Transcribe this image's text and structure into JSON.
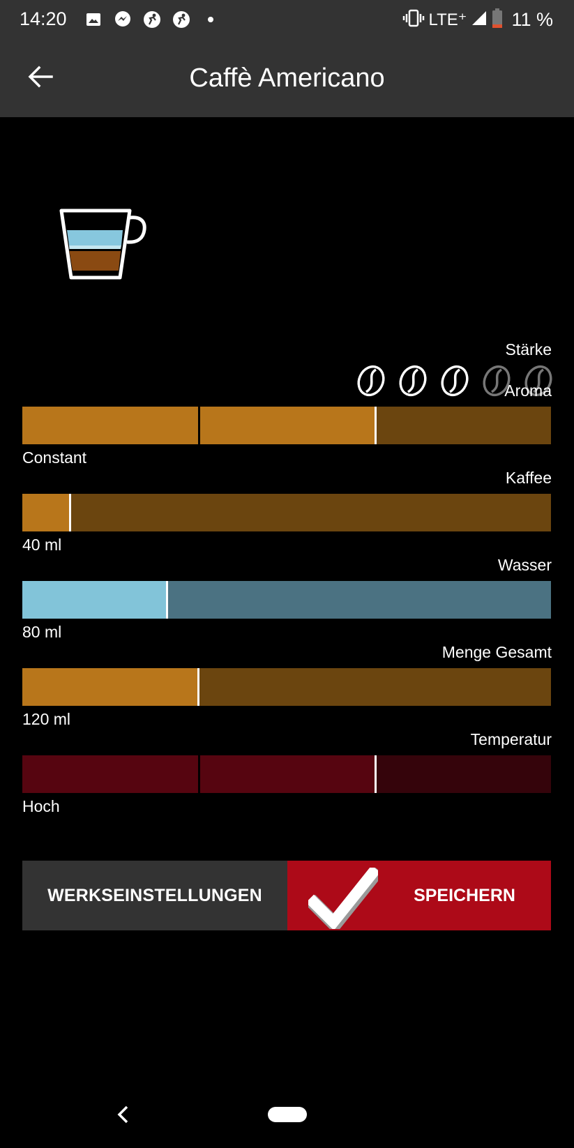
{
  "status_bar": {
    "time": "14:20",
    "network": "LTE⁺",
    "battery": "11 %",
    "icons": [
      "image-icon",
      "messenger-icon",
      "soccer-icon",
      "soccer-icon",
      "dot-icon",
      "vibrate-icon",
      "signal-icon",
      "battery-low-icon"
    ]
  },
  "header": {
    "title": "Caffè Americano",
    "back_icon": "arrow-left-icon"
  },
  "strength": {
    "label": "Stärke",
    "value": 3,
    "max": 5
  },
  "sliders": [
    {
      "id": "aroma",
      "label": "Aroma",
      "value_text": "Constant",
      "level": 0.667,
      "segments": 3,
      "active_color": "#b8761b",
      "inactive_color": "#6b450f"
    },
    {
      "id": "kaffee",
      "label": "Kaffee",
      "value_text": "40 ml",
      "level": 0.09,
      "segments": 1,
      "active_color": "#b8761b",
      "inactive_color": "#6b450f"
    },
    {
      "id": "wasser",
      "label": "Wasser",
      "value_text": "80 ml",
      "level": 0.273,
      "segments": 1,
      "active_color": "#82c4d9",
      "inactive_color": "#4b7282"
    },
    {
      "id": "menge",
      "label": "Menge Gesamt",
      "value_text": "120 ml",
      "level": 0.333,
      "segments": 1,
      "active_color": "#b8761b",
      "inactive_color": "#6b450f"
    },
    {
      "id": "temperatur",
      "label": "Temperatur",
      "value_text": "Hoch",
      "level": 0.667,
      "segments": 3,
      "active_color": "#560510",
      "inactive_color": "#35040b"
    }
  ],
  "buttons": {
    "factory_reset": "WERKSEINSTELLUNGEN",
    "save": "SPEICHERN"
  },
  "colors": {
    "bar_background": "#333333",
    "save_red": "#ad0a18",
    "bean_active": "#ffffff",
    "bean_inactive": "#777777"
  }
}
